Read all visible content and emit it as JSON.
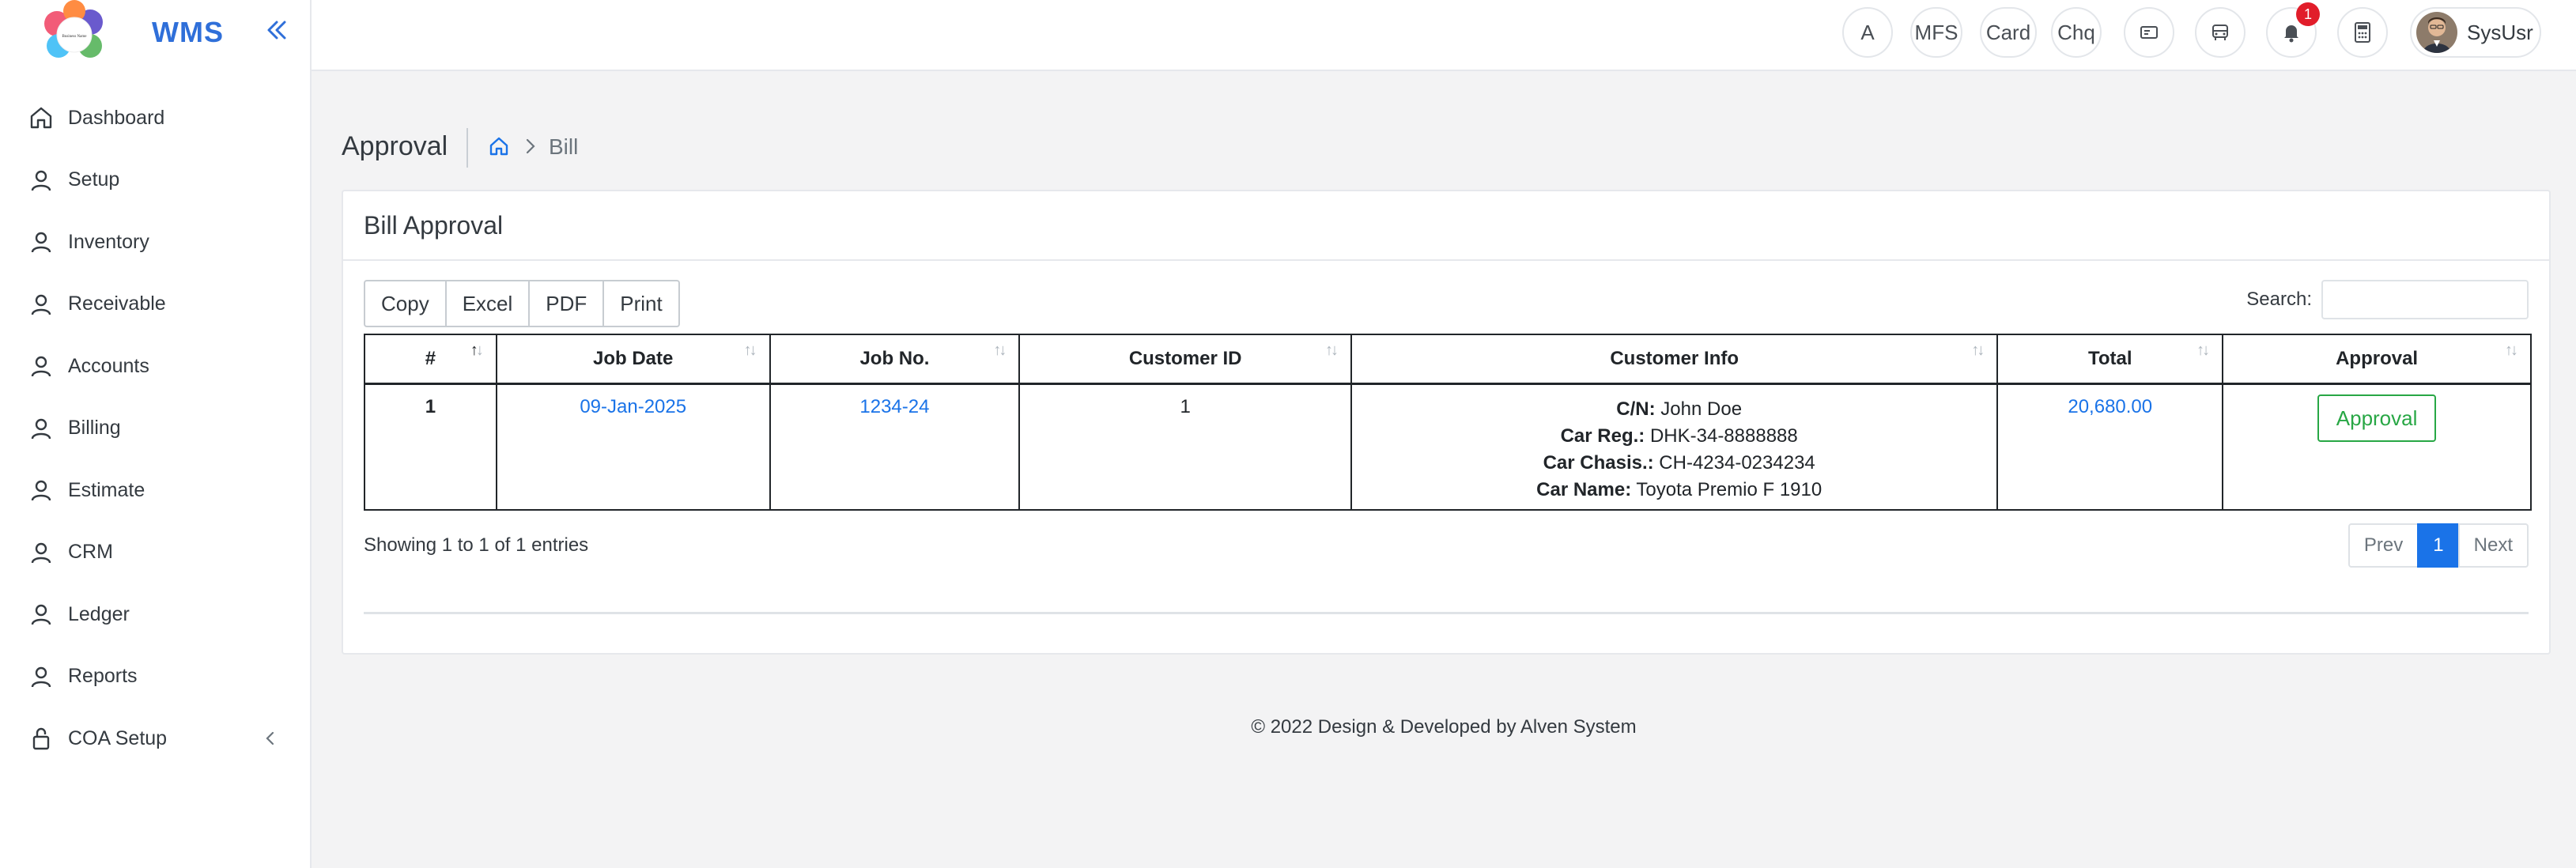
{
  "app": {
    "title": "WMS",
    "logo_text": "Business Name"
  },
  "sidebar": {
    "items": [
      {
        "label": "Dashboard",
        "icon": "home-icon"
      },
      {
        "label": "Setup",
        "icon": "user-icon"
      },
      {
        "label": "Inventory",
        "icon": "user-icon"
      },
      {
        "label": "Receivable",
        "icon": "user-icon"
      },
      {
        "label": "Accounts",
        "icon": "user-icon"
      },
      {
        "label": "Billing",
        "icon": "user-icon"
      },
      {
        "label": "Estimate",
        "icon": "user-icon"
      },
      {
        "label": "CRM",
        "icon": "user-icon"
      },
      {
        "label": "Ledger",
        "icon": "user-icon"
      },
      {
        "label": "Reports",
        "icon": "user-icon"
      },
      {
        "label": "COA Setup",
        "icon": "lock-icon"
      }
    ]
  },
  "topbar": {
    "btn_a": "A",
    "btn_mfs": "MFS",
    "btn_card": "Card",
    "btn_chq": "Chq",
    "notification_count": "1",
    "user_name": "SysUsr"
  },
  "page": {
    "title": "Approval",
    "breadcrumb_current": "Bill"
  },
  "card": {
    "title": "Bill Approval",
    "buttons": {
      "copy": "Copy",
      "excel": "Excel",
      "pdf": "PDF",
      "print": "Print"
    },
    "search_label": "Search:",
    "search_value": "",
    "columns": [
      "#",
      "Job Date",
      "Job No.",
      "Customer ID",
      "Customer Info",
      "Total",
      "Approval"
    ],
    "rows": [
      {
        "index": "1",
        "job_date": "09-Jan-2025",
        "job_no": "1234-24",
        "customer_id": "1",
        "info": {
          "cn_label": "C/N:",
          "cn": "John Doe",
          "reg_label": "Car Reg.:",
          "reg": "DHK-34-8888888",
          "chasis_label": "Car Chasis.:",
          "chasis": "CH-4234-0234234",
          "name_label": "Car Name:",
          "name": "Toyota Premio F 1910"
        },
        "total": "20,680.00",
        "approval": "Approval"
      }
    ],
    "showing": "Showing 1 to 1 of 1 entries",
    "pager": {
      "prev": "Prev",
      "current": "1",
      "next": "Next"
    }
  },
  "footer": "© 2022 Design & Developed by Alven System",
  "colors": {
    "brand": "#2f6fd9",
    "link": "#1a73e8",
    "approve": "#28a745",
    "badge": "#e11d2a"
  }
}
